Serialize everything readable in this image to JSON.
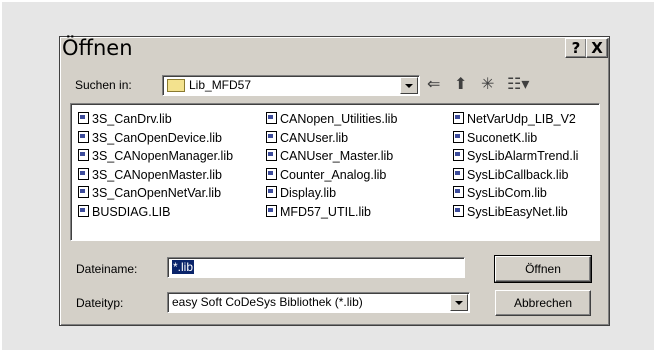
{
  "dialog": {
    "title": "Öffnen",
    "help_label": "?",
    "close_label": "X"
  },
  "look_in": {
    "label": "Suchen in:",
    "value": "Lib_MFD57"
  },
  "toolbar": {
    "back": "⇐",
    "up": "⬆",
    "new_folder": "✳",
    "view": "☷▾"
  },
  "files": {
    "col1": [
      "3S_CanDrv.lib",
      "3S_CanOpenDevice.lib",
      "3S_CANopenManager.lib",
      "3S_CANopenMaster.lib",
      "3S_CanOpenNetVar.lib",
      "BUSDIAG.LIB"
    ],
    "col2": [
      "CANopen_Utilities.lib",
      "CANUser.lib",
      "CANUser_Master.lib",
      "Counter_Analog.lib",
      "Display.lib",
      "MFD57_UTIL.lib"
    ],
    "col3": [
      "NetVarUdp_LIB_V2",
      "SuconetK.lib",
      "SysLibAlarmTrend.li",
      "SysLibCallback.lib",
      "SysLibCom.lib",
      "SysLibEasyNet.lib"
    ]
  },
  "filename": {
    "label": "Dateiname:",
    "value": "*.lib"
  },
  "filetype": {
    "label": "Dateityp:",
    "value": "easy Soft CoDeSys Bibliothek (*.lib)"
  },
  "buttons": {
    "open": "Öffnen",
    "cancel": "Abbrechen"
  }
}
